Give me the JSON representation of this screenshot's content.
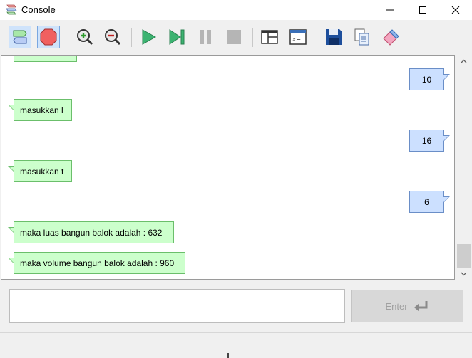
{
  "window": {
    "title": "Console"
  },
  "toolbar": {
    "buttons": [
      {
        "name": "toggle-bubble-view-button",
        "icon": "speech-bubbles-icon"
      },
      {
        "name": "stop-button",
        "icon": "stop-octagon-icon"
      },
      {
        "name": "zoom-in-button",
        "icon": "zoom-in-icon"
      },
      {
        "name": "zoom-out-button",
        "icon": "zoom-out-icon"
      },
      {
        "name": "run-button",
        "icon": "play-icon"
      },
      {
        "name": "step-button",
        "icon": "step-forward-icon"
      },
      {
        "name": "pause-button",
        "icon": "pause-icon"
      },
      {
        "name": "halt-button",
        "icon": "square-stop-icon"
      },
      {
        "name": "layout-button",
        "icon": "layout-panels-icon"
      },
      {
        "name": "variables-button",
        "icon": "variables-icon"
      },
      {
        "name": "save-button",
        "icon": "floppy-disk-icon"
      },
      {
        "name": "copy-button",
        "icon": "copy-icon"
      },
      {
        "name": "clear-button",
        "icon": "eraser-icon"
      }
    ]
  },
  "console": {
    "messages": [
      {
        "type": "in",
        "text": ""
      },
      {
        "type": "out",
        "text": "10"
      },
      {
        "type": "in",
        "text": "masukkan l"
      },
      {
        "type": "out",
        "text": "16"
      },
      {
        "type": "in",
        "text": "masukkan t"
      },
      {
        "type": "out",
        "text": "6"
      },
      {
        "type": "in",
        "text": "maka luas bangun balok adalah : 632"
      },
      {
        "type": "in",
        "text": "maka volume bangun balok adalah : 960"
      }
    ]
  },
  "input": {
    "value": "",
    "placeholder": ""
  },
  "enter_button": {
    "label": "Enter"
  },
  "colors": {
    "input_bubble_bg": "#ccffcc",
    "input_bubble_border": "#6bbf6b",
    "output_bubble_bg": "#cce0ff",
    "output_bubble_border": "#6a8ec7",
    "run_green": "#3cb371"
  }
}
